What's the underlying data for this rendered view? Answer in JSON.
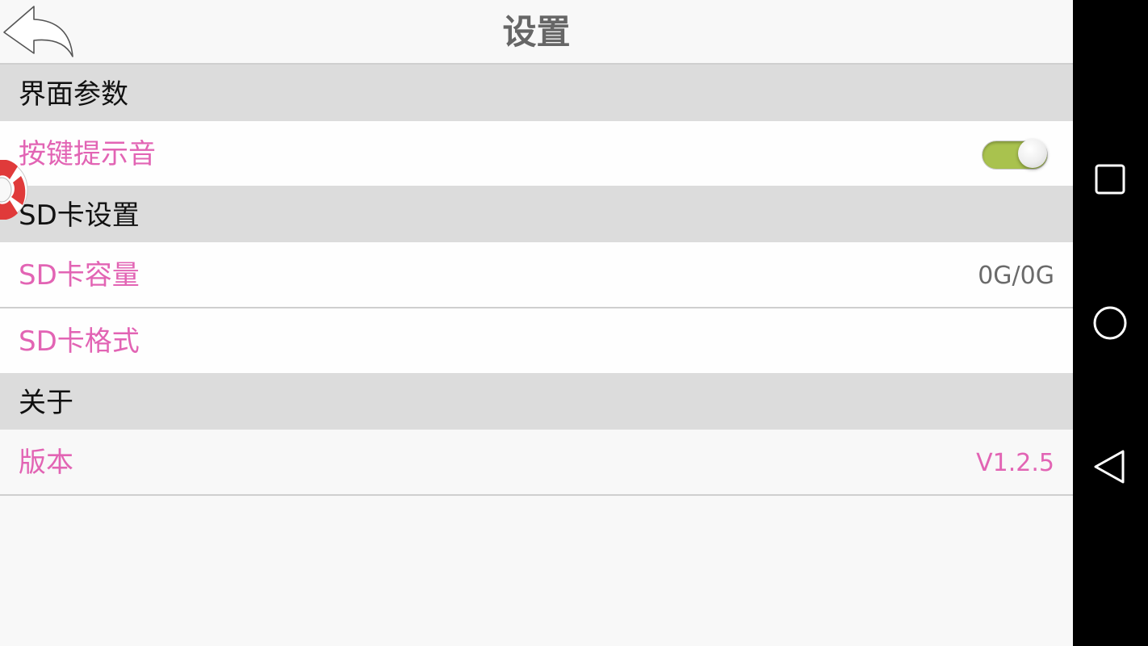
{
  "header": {
    "title": "设置",
    "back_icon": "back-arrow-icon"
  },
  "sections": [
    {
      "label": "界面参数",
      "rows": [
        {
          "label": "按键提示音",
          "control": "toggle",
          "toggle_on": true
        }
      ]
    },
    {
      "label": "SD卡设置",
      "rows": [
        {
          "label": "SD卡容量",
          "value": "0G/0G"
        },
        {
          "label": "SD卡格式"
        }
      ]
    },
    {
      "label": "关于",
      "rows": [
        {
          "label": "版本",
          "value": "V1.2.5"
        }
      ]
    }
  ],
  "colors": {
    "accent_pink": "#e264b4",
    "toggle_on": "#a9c24e",
    "section_bg": "#dcdcdc",
    "title_gray": "#666666"
  },
  "floating_widget": {
    "icon": "life-ring-icon"
  },
  "navbar": {
    "icons": [
      "recent-apps-icon",
      "home-icon",
      "back-icon"
    ]
  }
}
